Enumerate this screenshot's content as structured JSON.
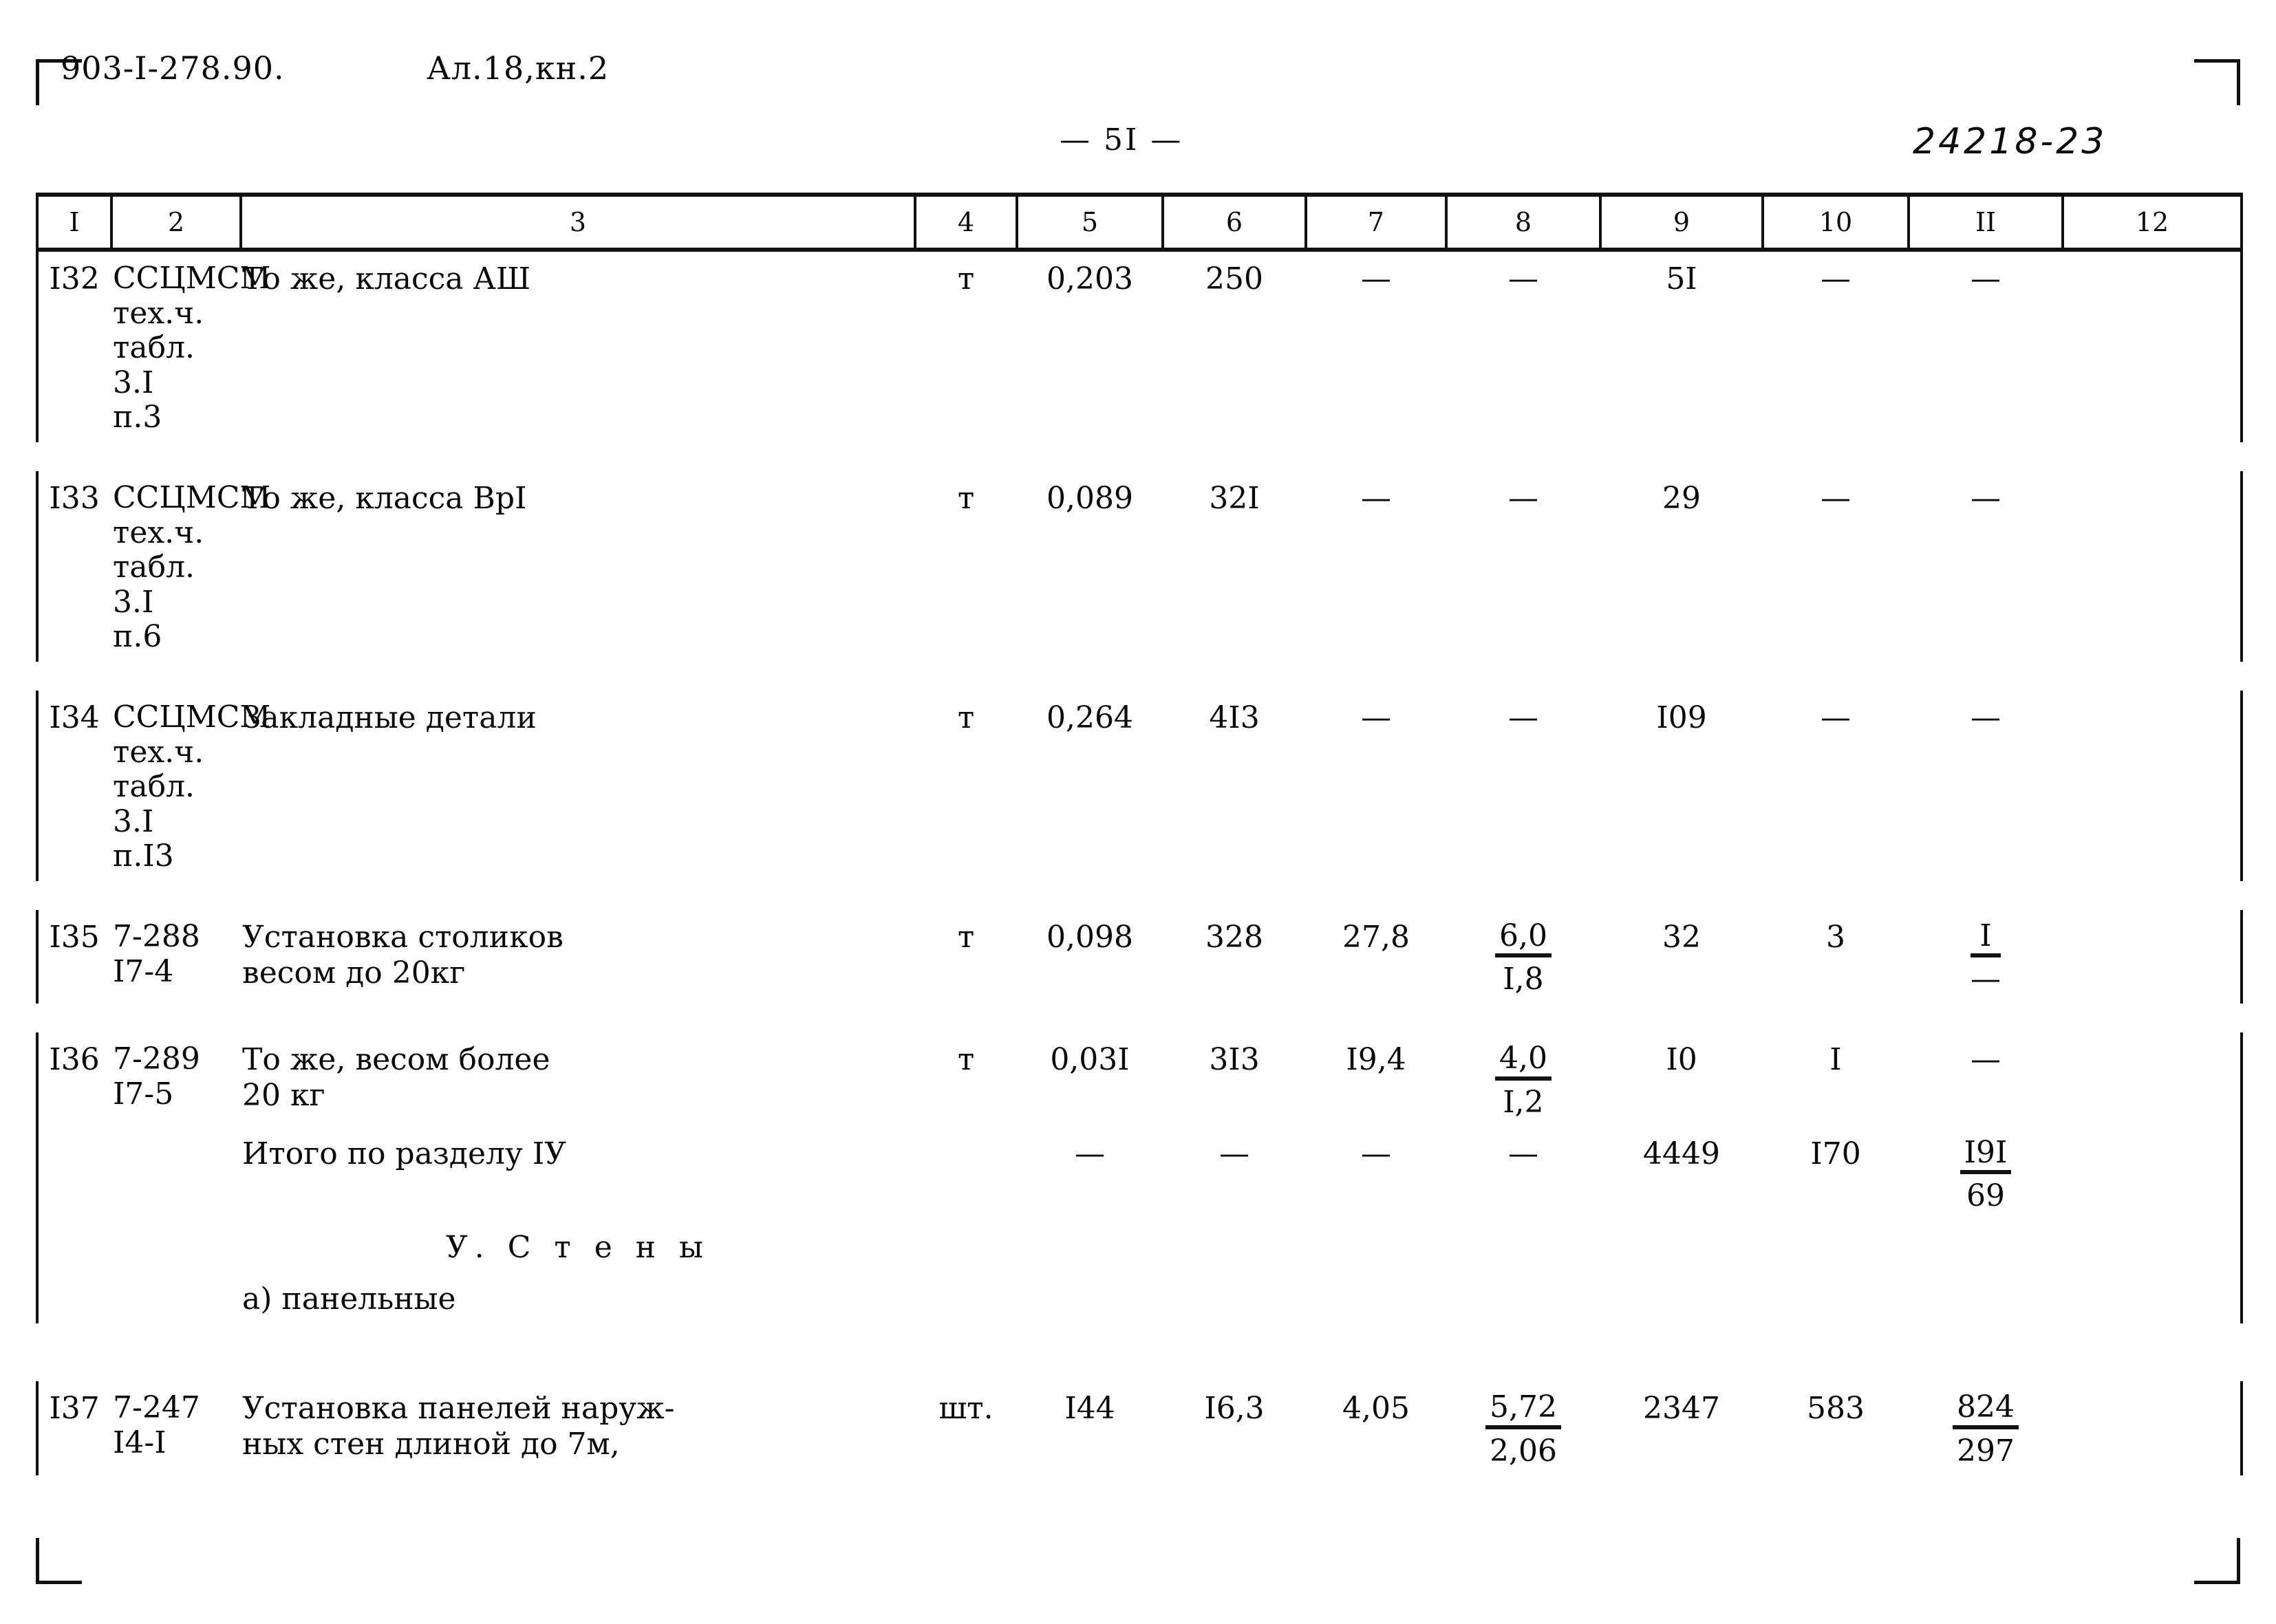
{
  "header": {
    "album_code": "903-I-278.90.",
    "album_ref": "Ал.18,кн.2",
    "page_number": "— 5I —",
    "archive_number": "24218-23"
  },
  "table": {
    "column_numbers": [
      "I",
      "2",
      "3",
      "4",
      "5",
      "6",
      "7",
      "8",
      "9",
      "10",
      "II",
      "12"
    ],
    "rows": [
      {
        "pos": "I32",
        "justification": "ССЦМСМ\nтех.ч.\nтабл.\n3.I\nп.3",
        "name": "То же, класса АШ",
        "unit": "т",
        "c5": "0,203",
        "c6": "250",
        "c7": "—",
        "c8": "—",
        "c9": "5I",
        "c10": "—",
        "c11": "—",
        "c12": ""
      },
      {
        "pos": "I33",
        "justification": "ССЦМСМ\nтех.ч.\nтабл.\n3.I\nп.6",
        "name": "То же, класса ВрI",
        "unit": "т",
        "c5": "0,089",
        "c6": "32I",
        "c7": "—",
        "c8": "—",
        "c9": "29",
        "c10": "—",
        "c11": "—",
        "c12": ""
      },
      {
        "pos": "I34",
        "justification": "ССЦМСМ\nтех.ч.\nтабл.\n3.I\nп.I3",
        "name": "Закладные детали",
        "unit": "т",
        "c5": "0,264",
        "c6": "4I3",
        "c7": "—",
        "c8": "—",
        "c9": "I09",
        "c10": "—",
        "c11": "—",
        "c12": ""
      },
      {
        "pos": "I35",
        "justification": "7-288\nI7-4",
        "name": "Установка столиков\nвесом до 20кг",
        "unit": "т",
        "c5": "0,098",
        "c6": "328",
        "c7": "27,8",
        "c8_top": "6,0",
        "c8_bot": "I,8",
        "c9": "32",
        "c10": "3",
        "c11_top": "I",
        "c11_bot": "—",
        "c12": ""
      },
      {
        "pos": "I36",
        "justification": "7-289\nI7-5",
        "name": "То же, весом более\n        20 кг",
        "unit": "т",
        "c5": "0,03I",
        "c6": "3I3",
        "c7": "I9,4",
        "c8_top": "4,0",
        "c8_bot": "I,2",
        "c9": "I0",
        "c10": "I",
        "c11": "—",
        "c12": ""
      },
      {
        "pos": "",
        "justification": "",
        "name": "Итого по разделу IУ",
        "unit": "",
        "c5": "—",
        "c6": "—",
        "c7": "—",
        "c8": "—",
        "c9": "4449",
        "c10": "I70",
        "c11_top": "I9I",
        "c11_bot": "69",
        "c12": ""
      },
      {
        "pos": "I37",
        "justification": "7-247\nI4-I",
        "name": "Установка панелей наруж-\nных стен длиной до 7м,",
        "unit": "шт.",
        "c5": "I44",
        "c6": "I6,3",
        "c7": "4,05",
        "c8_top": "5,72",
        "c8_bot": "2,06",
        "c9": "2347",
        "c10": "583",
        "c11_top": "824",
        "c11_bot": "297",
        "c12": ""
      }
    ],
    "section_heading": "У.  С т е н ы",
    "subsection_heading": "а) панельные"
  }
}
